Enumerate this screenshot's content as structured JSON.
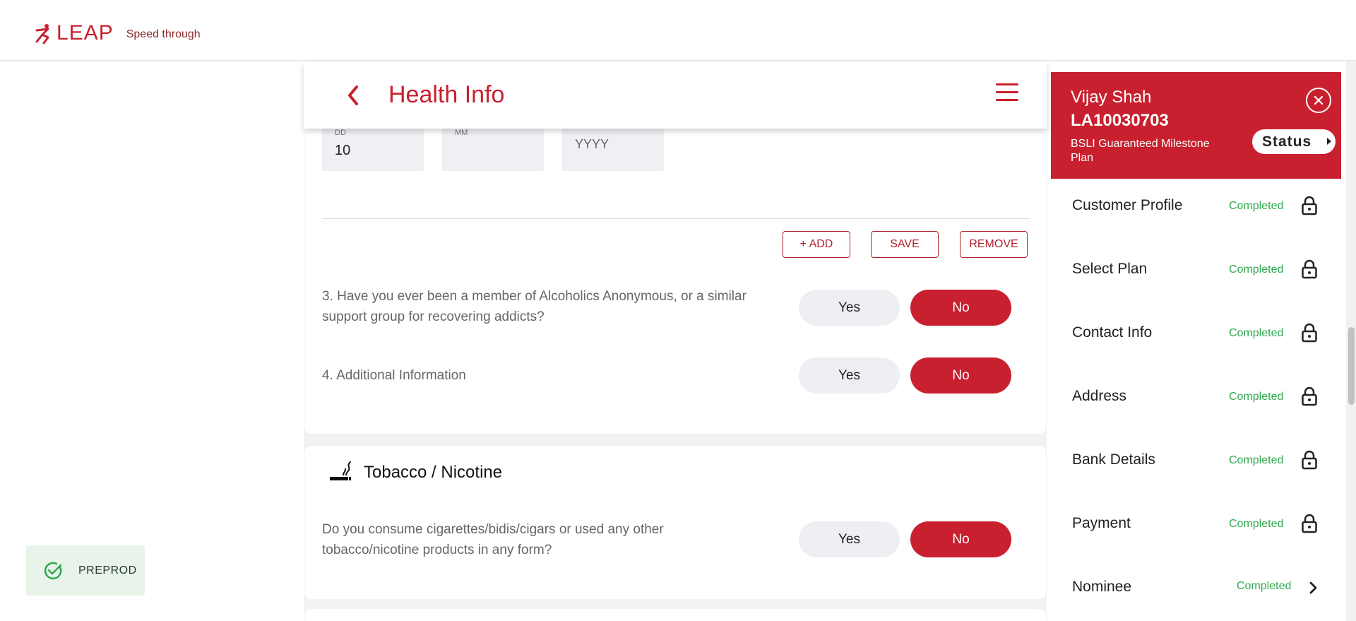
{
  "brand": {
    "logo_text": "LEAP",
    "tagline": "Speed through",
    "accent_color": "#c8202e"
  },
  "header": {
    "title": "Health Info",
    "back_icon": "chevron-left-icon",
    "menu_icon": "hamburger-menu-icon"
  },
  "date_fields": {
    "dd": {
      "label": "DD",
      "value": "10"
    },
    "mm": {
      "label": "MM",
      "value": ""
    },
    "yyyy": {
      "placeholder": "YYYY"
    }
  },
  "actions": {
    "add_label": "+ ADD",
    "save_label": "SAVE",
    "remove_label": "REMOVE"
  },
  "questions": [
    {
      "text_line1": "3. Have you ever been a member of Alcoholics Anonymous, or a similar",
      "text_line2": "support group for recovering addicts?",
      "yes": "Yes",
      "no": "No",
      "selected": "No"
    },
    {
      "text": "4. Additional Information",
      "yes": "Yes",
      "no": "No",
      "selected": "No"
    }
  ],
  "tobacco": {
    "title": "Tobacco / Nicotine",
    "icon": "smoking-icon",
    "question_line1": "Do you consume cigarettes/bidis/cigars or used any other",
    "question_line2": "tobacco/nicotine products in any form?",
    "yes": "Yes",
    "no": "No",
    "selected": "No"
  },
  "customer": {
    "name": "Vijay Shah",
    "application_id": "LA10030703",
    "plan": "BSLI Guaranteed Milestone Plan",
    "status_label": "Status"
  },
  "steps": [
    {
      "label": "Customer Profile",
      "status": "Completed",
      "icon": "lock-icon"
    },
    {
      "label": "Select Plan",
      "status": "Completed",
      "icon": "lock-icon"
    },
    {
      "label": "Contact Info",
      "status": "Completed",
      "icon": "lock-icon"
    },
    {
      "label": "Address",
      "status": "Completed",
      "icon": "lock-icon"
    },
    {
      "label": "Bank Details",
      "status": "Completed",
      "icon": "lock-icon"
    },
    {
      "label": "Payment",
      "status": "Completed",
      "icon": "lock-icon"
    },
    {
      "label": "Nominee",
      "status": "Completed",
      "icon": "chevron-right-icon"
    }
  ],
  "toast": {
    "text": "PREPROD",
    "icon": "check-circle-icon",
    "color": "#2fa84f"
  }
}
